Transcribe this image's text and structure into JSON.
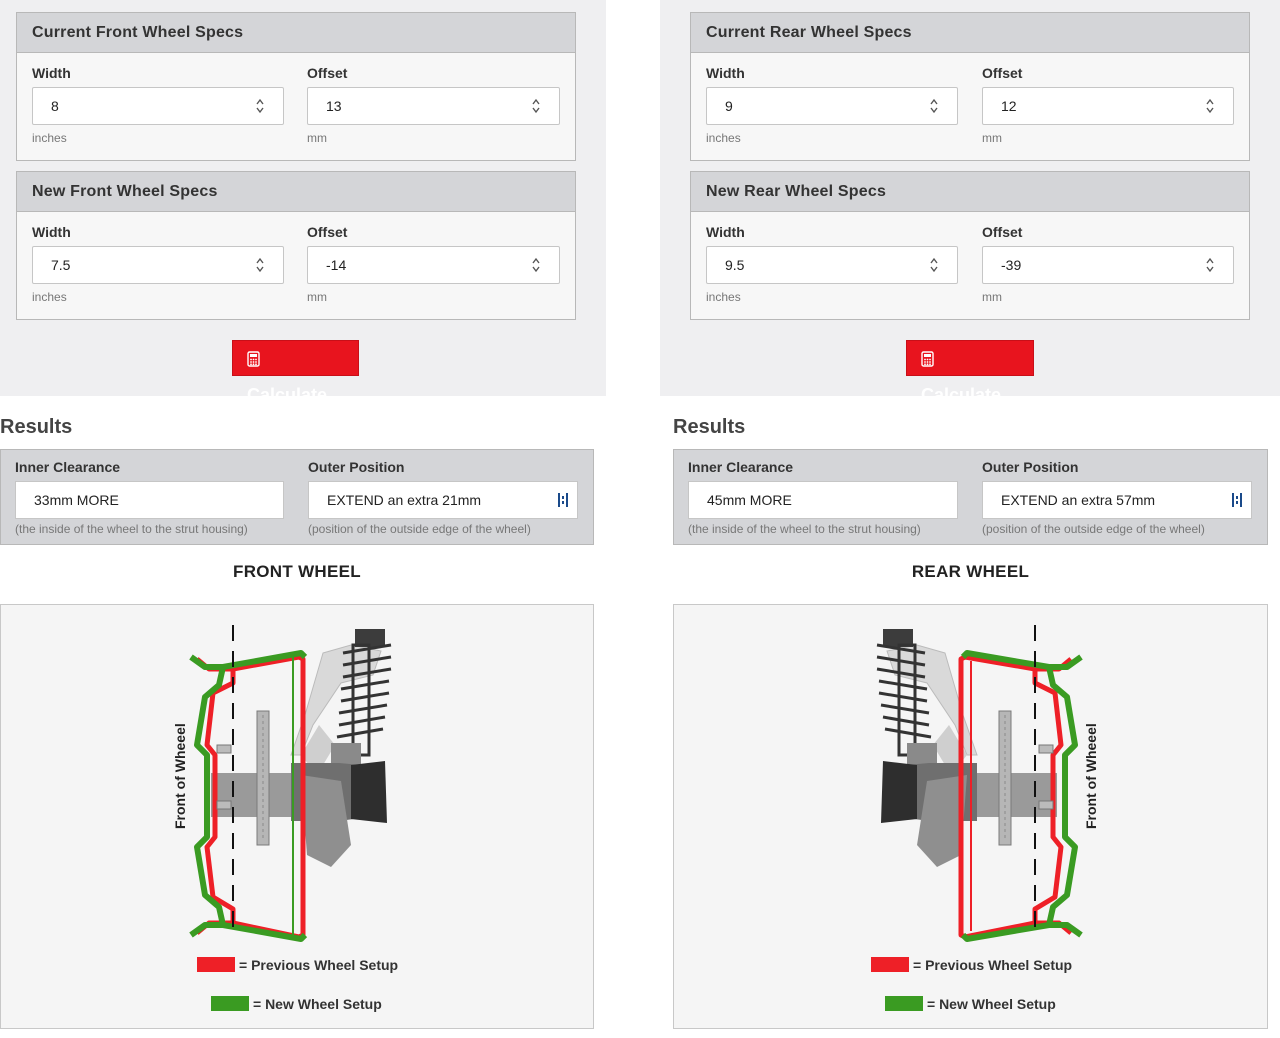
{
  "front": {
    "current": {
      "title": "Current Front Wheel Specs",
      "width_label": "Width",
      "width_value": "8",
      "width_unit": "inches",
      "offset_label": "Offset",
      "offset_value": "13",
      "offset_unit": "mm"
    },
    "new": {
      "title": "New Front Wheel Specs",
      "width_label": "Width",
      "width_value": "7.5",
      "width_unit": "inches",
      "offset_label": "Offset",
      "offset_value": "-14",
      "offset_unit": "mm"
    },
    "calculate_label": "Calculate",
    "results_title": "Results",
    "inner_label": "Inner Clearance",
    "inner_value": "33mm MORE",
    "inner_note": "(the inside of the wheel to the strut housing)",
    "outer_label": "Outer Position",
    "outer_value": "EXTEND an extra 21mm",
    "outer_note": "(position of the outside edge of the wheel)",
    "wheel_title": "FRONT WHEEL",
    "diagram_label": "Front of Wheeel"
  },
  "rear": {
    "current": {
      "title": "Current Rear Wheel Specs",
      "width_label": "Width",
      "width_value": "9",
      "width_unit": "inches",
      "offset_label": "Offset",
      "offset_value": "12",
      "offset_unit": "mm"
    },
    "new": {
      "title": "New Rear Wheel Specs",
      "width_label": "Width",
      "width_value": "9.5",
      "width_unit": "inches",
      "offset_label": "Offset",
      "offset_value": "-39",
      "offset_unit": "mm"
    },
    "calculate_label": "Calculate",
    "results_title": "Results",
    "inner_label": "Inner Clearance",
    "inner_value": "45mm MORE",
    "inner_note": "(the inside of the wheel to the strut housing)",
    "outer_label": "Outer Position",
    "outer_value": "EXTEND an extra 57mm",
    "outer_note": "(position of the outside edge of the wheel)",
    "wheel_title": "REAR WHEEL",
    "diagram_label": "Front of Wheeel"
  },
  "legend": {
    "previous": "= Previous Wheel Setup",
    "new": "= New Wheel Setup"
  },
  "colors": {
    "accent_red": "#e8141e",
    "previous_setup": "#ee2027",
    "new_setup": "#3a9b22"
  },
  "icons": {
    "calculate": "calculator-icon",
    "spinner": "spinner-arrows-icon",
    "field_action": "form-autofill-icon"
  }
}
